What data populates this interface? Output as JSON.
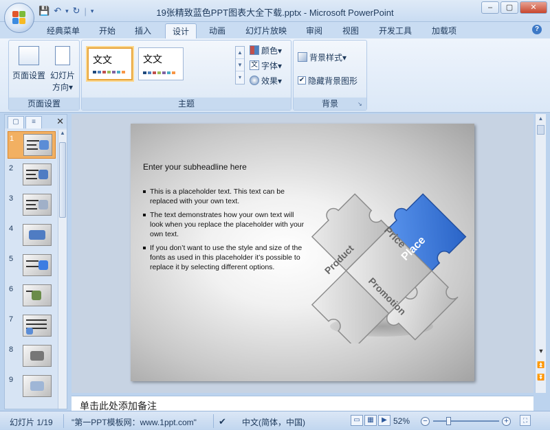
{
  "window": {
    "title": "19张精致蓝色PPT图表大全下载.pptx - Microsoft PowerPoint",
    "controls": [
      "–",
      "▢",
      "✕"
    ]
  },
  "qat": {
    "save": "💾",
    "undo": "↶",
    "undo_drop": "▾",
    "redo": "↻",
    "customize": "▾"
  },
  "tabs": [
    {
      "label": "经典菜单",
      "active": false
    },
    {
      "label": "开始",
      "active": false
    },
    {
      "label": "插入",
      "active": false
    },
    {
      "label": "设计",
      "active": true
    },
    {
      "label": "动画",
      "active": false
    },
    {
      "label": "幻灯片放映",
      "active": false
    },
    {
      "label": "审阅",
      "active": false
    },
    {
      "label": "视图",
      "active": false
    },
    {
      "label": "开发工具",
      "active": false
    },
    {
      "label": "加载项",
      "active": false
    }
  ],
  "help_icon": "?",
  "ribbon": {
    "page_setup": {
      "group_label": "页面设置",
      "page_setup_btn": "页面设置",
      "orientation_btn_line1": "幻灯片",
      "orientation_btn_line2": "方向▾"
    },
    "themes": {
      "group_label": "主题",
      "thumb1_text": "文文",
      "thumb2_text": "文文",
      "colors": "颜色▾",
      "fonts": "字体▾",
      "effects": "效果▾",
      "theme_colors": [
        "#1f497d",
        "#4f81bd",
        "#c0504d",
        "#9bbb59",
        "#8064a2",
        "#4bacc6",
        "#f79646"
      ]
    },
    "background": {
      "group_label": "背景",
      "bg_styles": "背景样式▾",
      "hide_bg": "隐藏背景图形",
      "hide_bg_checked": true
    }
  },
  "slides_pane": {
    "tab_slides": "▢",
    "tab_outline": "≡",
    "close": "✕",
    "thumbnails": [
      "1",
      "2",
      "3",
      "4",
      "5",
      "6",
      "7",
      "8",
      "9"
    ],
    "selected": 1
  },
  "slide": {
    "subheadline": "Enter your subheadline here",
    "bullets": [
      "This is a placeholder text. This text can be replaced with your own text.",
      "The text demonstrates how your own text will look when you replace the placeholder with your own text.",
      "If you don’t want to use the style and size of the fonts as used in this placeholder it’s possible to replace it by selecting different options."
    ],
    "puzzle_labels": {
      "price": "Price",
      "place": "Place",
      "product": "Product",
      "promotion": "Promotion"
    },
    "colors": {
      "gray_piece": "#d4d4d4",
      "blue_piece": "#3d7de2"
    }
  },
  "notes": {
    "placeholder": "单击此处添加备注"
  },
  "status": {
    "slide_count": "幻灯片 1/19",
    "theme_name": "\"第一PPT模板网：www.1ppt.com\"",
    "language": "中文(简体，中国)",
    "zoom": "52%",
    "zoom_level": 52
  }
}
